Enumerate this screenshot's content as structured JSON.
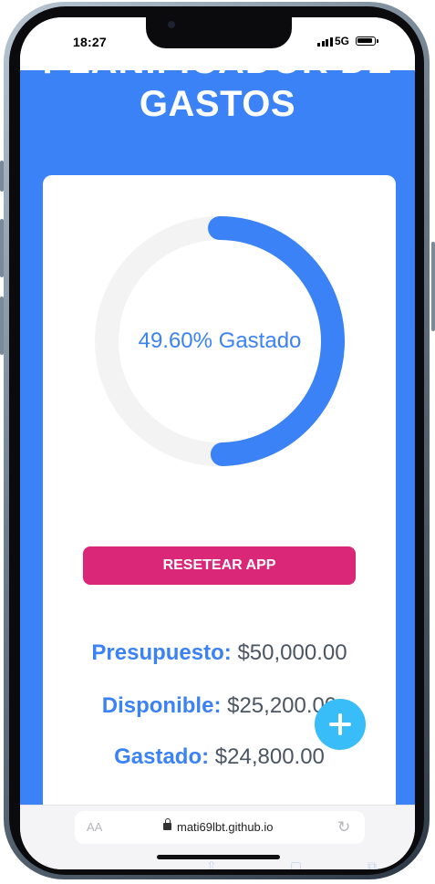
{
  "status_bar": {
    "time": "18:27",
    "network": "5G"
  },
  "page": {
    "title_cut": "PLANIFICADOR DE",
    "title": "GASTOS",
    "colors": {
      "header_bg": "#3b82f6",
      "accent": "#3b82f6",
      "reset_button": "#db2777",
      "fab": "#38bdf8"
    }
  },
  "progress": {
    "percent": 49.6,
    "label": "49.60% Gastado"
  },
  "reset_button": {
    "label": "Resetear App"
  },
  "stats": {
    "budget_label": "Presupuesto:",
    "budget_value": "$50,000.00",
    "available_label": "Disponible:",
    "available_value": "$25,200.00",
    "spent_label": "Gastado:",
    "spent_value": "$24,800.00"
  },
  "fab": {
    "icon": "plus-icon"
  },
  "browser": {
    "text_size_label": "AA",
    "url": "mati69lbt.github.io",
    "lock_icon": "lock-icon",
    "reload_icon": "reload-icon"
  }
}
